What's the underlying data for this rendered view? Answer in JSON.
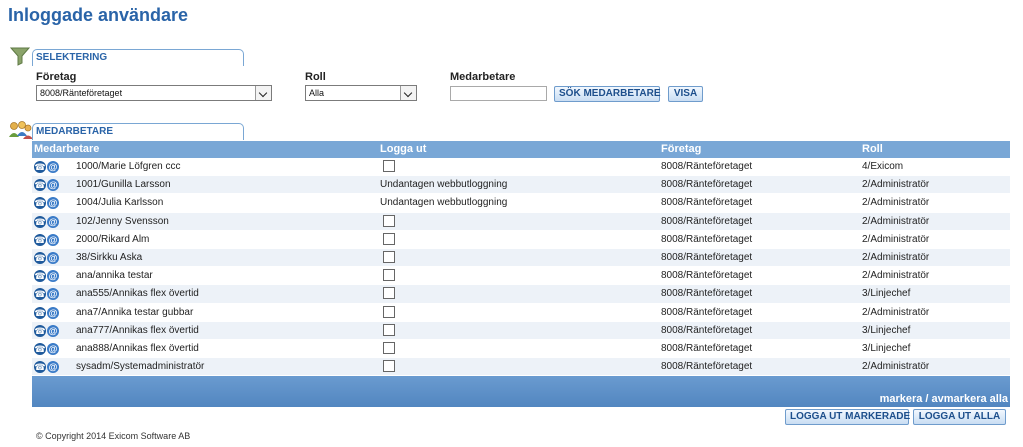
{
  "page": {
    "title": "Inloggade användare"
  },
  "selection": {
    "heading": "SELEKTERING",
    "company_label": "Företag",
    "company_value": "8008/Ränteföretaget",
    "role_label": "Roll",
    "role_value": "Alla",
    "employee_label": "Medarbetare",
    "employee_value": "",
    "search_button": "SÖK MEDARBETARE",
    "show_button": "VISA"
  },
  "employees": {
    "heading": "MEDARBETARE",
    "columns": [
      "Medarbetare",
      "Logga ut",
      "Företag",
      "Roll"
    ],
    "rows": [
      {
        "name": "1000/Marie Löfgren ccc",
        "logout": "",
        "company": "8008/Ränteföretaget",
        "role": "4/Exicom"
      },
      {
        "name": "1001/Gunilla Larsson",
        "logout": "Undantagen webbutloggning",
        "company": "8008/Ränteföretaget",
        "role": "2/Administratör"
      },
      {
        "name": "1004/Julia Karlsson",
        "logout": "Undantagen webbutloggning",
        "company": "8008/Ränteföretaget",
        "role": "2/Administratör"
      },
      {
        "name": "102/Jenny Svensson",
        "logout": "",
        "company": "8008/Ränteföretaget",
        "role": "2/Administratör"
      },
      {
        "name": "2000/Rikard Alm",
        "logout": "",
        "company": "8008/Ränteföretaget",
        "role": "2/Administratör"
      },
      {
        "name": "38/Sirkku Aska",
        "logout": "",
        "company": "8008/Ränteföretaget",
        "role": "2/Administratör"
      },
      {
        "name": "ana/annika testar",
        "logout": "",
        "company": "8008/Ränteföretaget",
        "role": "2/Administratör"
      },
      {
        "name": "ana555/Annikas flex övertid",
        "logout": "",
        "company": "8008/Ränteföretaget",
        "role": "3/Linjechef"
      },
      {
        "name": "ana7/Annika testar gubbar",
        "logout": "",
        "company": "8008/Ränteföretaget",
        "role": "2/Administratör"
      },
      {
        "name": "ana777/Annikas flex övertid",
        "logout": "",
        "company": "8008/Ränteföretaget",
        "role": "3/Linjechef"
      },
      {
        "name": "ana888/Annikas flex övertid",
        "logout": "",
        "company": "8008/Ränteföretaget",
        "role": "3/Linjechef"
      },
      {
        "name": "sysadm/Systemadministratör",
        "logout": "",
        "company": "8008/Ränteföretaget",
        "role": "2/Administratör"
      }
    ],
    "toggle_all": "markera / avmarkera alla",
    "logout_selected": "LOGGA UT MARKERADE",
    "logout_all": "LOGGA UT ALLA"
  },
  "footer": {
    "copyright": "© Copyright 2014 Exicom Software AB"
  }
}
